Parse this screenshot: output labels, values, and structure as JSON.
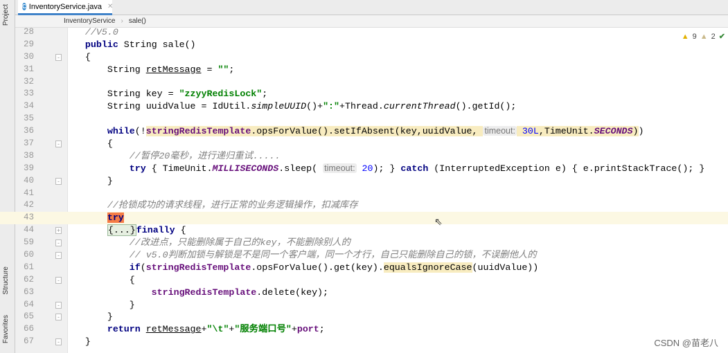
{
  "tab": {
    "title": "InventoryService.java",
    "icon": "C"
  },
  "breadcrumb": [
    "InventoryService",
    "sale()"
  ],
  "toolstrip": {
    "project": "Project",
    "structure": "Structure",
    "favorites": "Favorites"
  },
  "inspections": {
    "warnings": "9",
    "weak_warnings": "2"
  },
  "watermark": "CSDN @苗老八",
  "current_line": "43",
  "lines": [
    {
      "n": "28",
      "t": [
        [
          "",
          "    "
        ],
        [
          "cm",
          "//V5.0"
        ]
      ]
    },
    {
      "n": "29",
      "t": [
        [
          "",
          "    "
        ],
        [
          "kw",
          "public"
        ],
        [
          "",
          " String sale()"
        ]
      ]
    },
    {
      "n": "30",
      "f": "-",
      "t": [
        [
          "",
          "    {"
        ]
      ]
    },
    {
      "n": "31",
      "t": [
        [
          "",
          "        String "
        ],
        [
          "ul",
          "retMessage"
        ],
        [
          "",
          " = "
        ],
        [
          "str",
          "\"\""
        ],
        [
          "",
          ";"
        ]
      ]
    },
    {
      "n": "32",
      "t": []
    },
    {
      "n": "33",
      "t": [
        [
          "",
          "        String key = "
        ],
        [
          "str",
          "\"zzyyRedisLock\""
        ],
        [
          "",
          ";"
        ]
      ]
    },
    {
      "n": "34",
      "t": [
        [
          "",
          "        String uuidValue = IdUtil."
        ],
        [
          "it",
          "simpleUUID"
        ],
        [
          "",
          "()+"
        ],
        [
          "str",
          "\":\""
        ],
        [
          "",
          "+Thread."
        ],
        [
          "it",
          "currentThread"
        ],
        [
          "",
          "().getId();"
        ]
      ]
    },
    {
      "n": "35",
      "t": []
    },
    {
      "n": "36",
      "t": [
        [
          "",
          "        "
        ],
        [
          "kw",
          "while"
        ],
        [
          "",
          "(!"
        ],
        [
          "fld hl",
          "stringRedisTemplate"
        ],
        [
          "hl",
          ".opsForValue().setIfAbsent(key,uuidValue, "
        ],
        [
          "hint",
          "timeout:"
        ],
        [
          "num hl",
          " 30L"
        ],
        [
          "hl",
          ",TimeUnit."
        ],
        [
          "st hl",
          "SECONDS"
        ],
        [
          "hl",
          ")"
        ],
        [
          "",
          ")"
        ]
      ]
    },
    {
      "n": "37",
      "f": "-",
      "t": [
        [
          "",
          "        {"
        ]
      ]
    },
    {
      "n": "38",
      "t": [
        [
          "",
          "            "
        ],
        [
          "cm",
          "//暂停20毫秒，进行递归重试....."
        ]
      ]
    },
    {
      "n": "39",
      "t": [
        [
          "",
          "            "
        ],
        [
          "kw",
          "try"
        ],
        [
          "",
          " { TimeUnit."
        ],
        [
          "st",
          "MILLISECONDS"
        ],
        [
          "",
          ".sleep( "
        ],
        [
          "hint",
          "timeout:"
        ],
        [
          "num",
          " 20"
        ],
        [
          "",
          "); } "
        ],
        [
          "kw",
          "catch"
        ],
        [
          "",
          " (InterruptedException e) { e.printStackTrace(); }"
        ]
      ]
    },
    {
      "n": "40",
      "f": "-",
      "t": [
        [
          "",
          "        }"
        ]
      ]
    },
    {
      "n": "41",
      "t": []
    },
    {
      "n": "42",
      "t": [
        [
          "",
          "        "
        ],
        [
          "cm",
          "//抢锁成功的请求线程，进行正常的业务逻辑操作，扣减库存"
        ]
      ]
    },
    {
      "n": "43",
      "t": [
        [
          "",
          "        "
        ],
        [
          "trykw",
          "try"
        ]
      ]
    },
    {
      "n": "44",
      "f": "+",
      "t": [
        [
          "",
          "        "
        ],
        [
          "foldbox",
          "{...}"
        ],
        [
          "kw",
          "finally"
        ],
        [
          "",
          " {"
        ]
      ]
    },
    {
      "n": "59",
      "f": "-",
      "t": [
        [
          "",
          "            "
        ],
        [
          "cm",
          "//改进点，只能删除属于自己的key，不能删除别人的"
        ]
      ]
    },
    {
      "n": "60",
      "f": "-",
      "t": [
        [
          "",
          "            "
        ],
        [
          "cm",
          "// v5.0判断加锁与解锁是不是同一个客户端，同一个才行，自己只能删除自己的锁，不误删他人的"
        ]
      ]
    },
    {
      "n": "61",
      "t": [
        [
          "",
          "            "
        ],
        [
          "kw",
          "if"
        ],
        [
          "",
          "("
        ],
        [
          "fld",
          "stringRedisTemplate"
        ],
        [
          "",
          ".opsForValue().get(key)."
        ],
        [
          "hl",
          "equalsIgnoreCase"
        ],
        [
          "",
          "(uuidValue))"
        ]
      ]
    },
    {
      "n": "62",
      "f": "-",
      "t": [
        [
          "",
          "            {"
        ]
      ]
    },
    {
      "n": "63",
      "t": [
        [
          "",
          "                "
        ],
        [
          "fld",
          "stringRedisTemplate"
        ],
        [
          "",
          ".delete(key);"
        ]
      ]
    },
    {
      "n": "64",
      "f": "-",
      "t": [
        [
          "",
          "            }"
        ]
      ]
    },
    {
      "n": "65",
      "f": "-",
      "t": [
        [
          "",
          "        }"
        ]
      ]
    },
    {
      "n": "66",
      "t": [
        [
          "",
          "        "
        ],
        [
          "kw",
          "return"
        ],
        [
          "",
          " "
        ],
        [
          "ul",
          "retMessage"
        ],
        [
          "",
          "+"
        ],
        [
          "str",
          "\"\\t\""
        ],
        [
          "",
          "+"
        ],
        [
          "str",
          "\"服务端口号\""
        ],
        [
          "",
          "+"
        ],
        [
          "fld",
          "port"
        ],
        [
          "",
          ";"
        ]
      ]
    },
    {
      "n": "67",
      "f": "-",
      "t": [
        [
          "",
          "    }"
        ]
      ]
    }
  ]
}
